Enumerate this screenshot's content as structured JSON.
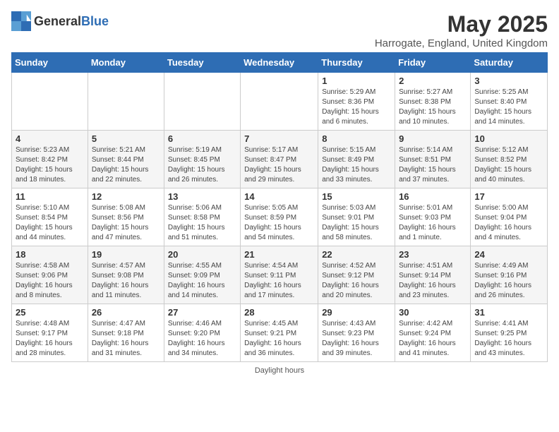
{
  "header": {
    "logo_general": "General",
    "logo_blue": "Blue",
    "month": "May 2025",
    "location": "Harrogate, England, United Kingdom"
  },
  "weekdays": [
    "Sunday",
    "Monday",
    "Tuesday",
    "Wednesday",
    "Thursday",
    "Friday",
    "Saturday"
  ],
  "weeks": [
    [
      {
        "day": "",
        "info": ""
      },
      {
        "day": "",
        "info": ""
      },
      {
        "day": "",
        "info": ""
      },
      {
        "day": "",
        "info": ""
      },
      {
        "day": "1",
        "info": "Sunrise: 5:29 AM\nSunset: 8:36 PM\nDaylight: 15 hours\nand 6 minutes."
      },
      {
        "day": "2",
        "info": "Sunrise: 5:27 AM\nSunset: 8:38 PM\nDaylight: 15 hours\nand 10 minutes."
      },
      {
        "day": "3",
        "info": "Sunrise: 5:25 AM\nSunset: 8:40 PM\nDaylight: 15 hours\nand 14 minutes."
      }
    ],
    [
      {
        "day": "4",
        "info": "Sunrise: 5:23 AM\nSunset: 8:42 PM\nDaylight: 15 hours\nand 18 minutes."
      },
      {
        "day": "5",
        "info": "Sunrise: 5:21 AM\nSunset: 8:44 PM\nDaylight: 15 hours\nand 22 minutes."
      },
      {
        "day": "6",
        "info": "Sunrise: 5:19 AM\nSunset: 8:45 PM\nDaylight: 15 hours\nand 26 minutes."
      },
      {
        "day": "7",
        "info": "Sunrise: 5:17 AM\nSunset: 8:47 PM\nDaylight: 15 hours\nand 29 minutes."
      },
      {
        "day": "8",
        "info": "Sunrise: 5:15 AM\nSunset: 8:49 PM\nDaylight: 15 hours\nand 33 minutes."
      },
      {
        "day": "9",
        "info": "Sunrise: 5:14 AM\nSunset: 8:51 PM\nDaylight: 15 hours\nand 37 minutes."
      },
      {
        "day": "10",
        "info": "Sunrise: 5:12 AM\nSunset: 8:52 PM\nDaylight: 15 hours\nand 40 minutes."
      }
    ],
    [
      {
        "day": "11",
        "info": "Sunrise: 5:10 AM\nSunset: 8:54 PM\nDaylight: 15 hours\nand 44 minutes."
      },
      {
        "day": "12",
        "info": "Sunrise: 5:08 AM\nSunset: 8:56 PM\nDaylight: 15 hours\nand 47 minutes."
      },
      {
        "day": "13",
        "info": "Sunrise: 5:06 AM\nSunset: 8:58 PM\nDaylight: 15 hours\nand 51 minutes."
      },
      {
        "day": "14",
        "info": "Sunrise: 5:05 AM\nSunset: 8:59 PM\nDaylight: 15 hours\nand 54 minutes."
      },
      {
        "day": "15",
        "info": "Sunrise: 5:03 AM\nSunset: 9:01 PM\nDaylight: 15 hours\nand 58 minutes."
      },
      {
        "day": "16",
        "info": "Sunrise: 5:01 AM\nSunset: 9:03 PM\nDaylight: 16 hours\nand 1 minute."
      },
      {
        "day": "17",
        "info": "Sunrise: 5:00 AM\nSunset: 9:04 PM\nDaylight: 16 hours\nand 4 minutes."
      }
    ],
    [
      {
        "day": "18",
        "info": "Sunrise: 4:58 AM\nSunset: 9:06 PM\nDaylight: 16 hours\nand 8 minutes."
      },
      {
        "day": "19",
        "info": "Sunrise: 4:57 AM\nSunset: 9:08 PM\nDaylight: 16 hours\nand 11 minutes."
      },
      {
        "day": "20",
        "info": "Sunrise: 4:55 AM\nSunset: 9:09 PM\nDaylight: 16 hours\nand 14 minutes."
      },
      {
        "day": "21",
        "info": "Sunrise: 4:54 AM\nSunset: 9:11 PM\nDaylight: 16 hours\nand 17 minutes."
      },
      {
        "day": "22",
        "info": "Sunrise: 4:52 AM\nSunset: 9:12 PM\nDaylight: 16 hours\nand 20 minutes."
      },
      {
        "day": "23",
        "info": "Sunrise: 4:51 AM\nSunset: 9:14 PM\nDaylight: 16 hours\nand 23 minutes."
      },
      {
        "day": "24",
        "info": "Sunrise: 4:49 AM\nSunset: 9:16 PM\nDaylight: 16 hours\nand 26 minutes."
      }
    ],
    [
      {
        "day": "25",
        "info": "Sunrise: 4:48 AM\nSunset: 9:17 PM\nDaylight: 16 hours\nand 28 minutes."
      },
      {
        "day": "26",
        "info": "Sunrise: 4:47 AM\nSunset: 9:18 PM\nDaylight: 16 hours\nand 31 minutes."
      },
      {
        "day": "27",
        "info": "Sunrise: 4:46 AM\nSunset: 9:20 PM\nDaylight: 16 hours\nand 34 minutes."
      },
      {
        "day": "28",
        "info": "Sunrise: 4:45 AM\nSunset: 9:21 PM\nDaylight: 16 hours\nand 36 minutes."
      },
      {
        "day": "29",
        "info": "Sunrise: 4:43 AM\nSunset: 9:23 PM\nDaylight: 16 hours\nand 39 minutes."
      },
      {
        "day": "30",
        "info": "Sunrise: 4:42 AM\nSunset: 9:24 PM\nDaylight: 16 hours\nand 41 minutes."
      },
      {
        "day": "31",
        "info": "Sunrise: 4:41 AM\nSunset: 9:25 PM\nDaylight: 16 hours\nand 43 minutes."
      }
    ]
  ],
  "footer": {
    "daylight_hours_label": "Daylight hours"
  }
}
